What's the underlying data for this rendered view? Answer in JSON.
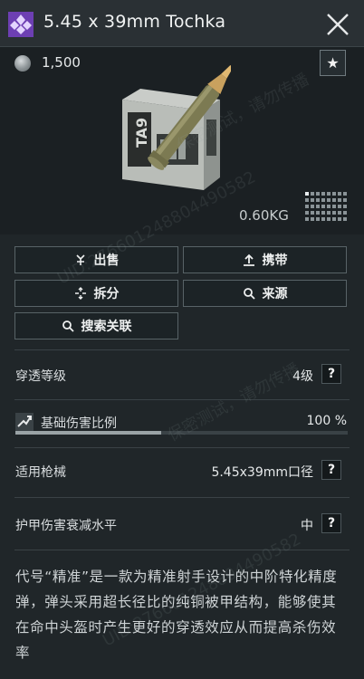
{
  "header": {
    "title": "5.45 x 39mm Tochka"
  },
  "item": {
    "price": "1,500",
    "weight": "0.60KG"
  },
  "actions": {
    "sell": "出售",
    "carry": "携带",
    "disassemble": "拆分",
    "source": "来源",
    "search": "搜索关联"
  },
  "stats": {
    "penetration": {
      "label": "穿透等级",
      "value": "4级"
    },
    "base_damage": {
      "label": "基础伤害比例",
      "value": "100 %",
      "fill": 0.44
    },
    "weapons": {
      "label": "适用枪械",
      "value": "5.45x39mm口径"
    },
    "armor_damage": {
      "label": "护甲伤害衰减水平",
      "value": "中"
    }
  },
  "description": "代号“精准”是一款为精准射手设计的中阶特化精度弹，弹头采用超长径比的纯铜被甲结构，能够使其在命中头盔时产生更好的穿透效应从而提高杀伤效率",
  "watermarks": {
    "warning": "保密测试，请勿传播",
    "uid": "UID:276601248804490582"
  },
  "colors": {
    "rarity": "#8f5ad6",
    "background": "#202629"
  }
}
